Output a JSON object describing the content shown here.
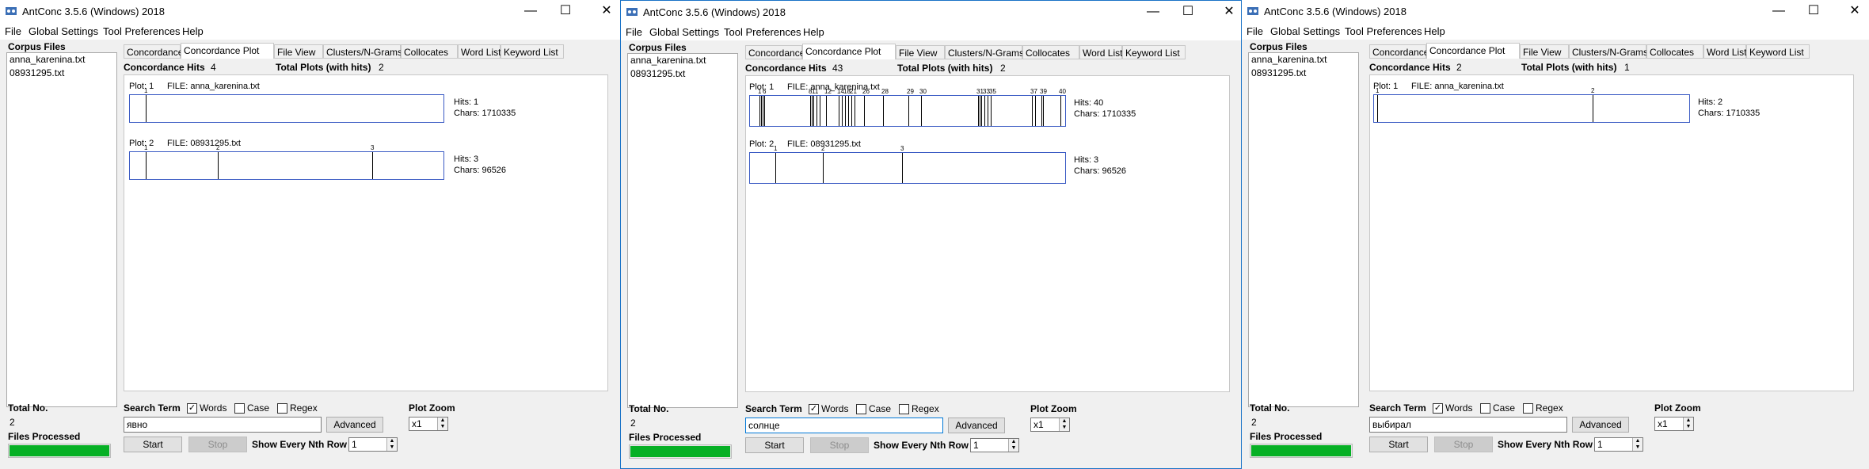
{
  "colors": {
    "progress": "#06b025",
    "plot_border": "#3b5bc4",
    "active_window_border": "#1a73c7"
  },
  "windows": [
    {
      "title": "AntConc 3.5.6 (Windows) 2018",
      "menu": [
        "File",
        "Global Settings",
        "Tool Preferences",
        "Help"
      ],
      "corpus_files_label": "Corpus Files",
      "corpus_files": [
        "anna_karenina.txt",
        "08931295.txt"
      ],
      "total_no_label": "Total No.",
      "total_no": "2",
      "files_processed_label": "Files Processed",
      "files_processed_fraction": 1.0,
      "tabs": [
        "Concordance",
        "Concordance Plot",
        "File View",
        "Clusters/N-Grams",
        "Collocates",
        "Word List",
        "Keyword List"
      ],
      "selected_tab": 1,
      "hits_label": "Concordance Hits",
      "hits": "4",
      "total_plots_label": "Total Plots (with hits)",
      "total_plots": "2",
      "plots": [
        {
          "plot_label": "Plot: 1",
          "file_label": "FILE: anna_karenina.txt",
          "hits_text": "Hits: 1",
          "chars_text": "Chars: 1710335",
          "marks": [
            {
              "pos": 0.05,
              "n": "1"
            }
          ]
        },
        {
          "plot_label": "Plot: 2",
          "file_label": "FILE: 08931295.txt",
          "hits_text": "Hits: 3",
          "chars_text": "Chars: 96526",
          "marks": [
            {
              "pos": 0.05,
              "n": "1"
            },
            {
              "pos": 0.28,
              "n": "2"
            },
            {
              "pos": 0.77,
              "n": "3"
            }
          ]
        }
      ],
      "search_term_label": "Search Term",
      "words_label": "Words",
      "words_checked": true,
      "case_label": "Case",
      "case_checked": false,
      "regex_label": "Regex",
      "regex_checked": false,
      "search_value": "явно",
      "advanced_label": "Advanced",
      "start_label": "Start",
      "stop_label": "Stop",
      "nth_row_label": "Show Every Nth Row",
      "nth_row_value": "1",
      "plot_zoom_label": "Plot Zoom",
      "plot_zoom_value": "x1"
    },
    {
      "title": "AntConc 3.5.6 (Windows) 2018",
      "menu": [
        "File",
        "Global Settings",
        "Tool Preferences",
        "Help"
      ],
      "corpus_files_label": "Corpus Files",
      "corpus_files": [
        "anna_karenina.txt",
        "08931295.txt"
      ],
      "total_no_label": "Total No.",
      "total_no": "2",
      "files_processed_label": "Files Processed",
      "files_processed_fraction": 1.0,
      "tabs": [
        "Concordance",
        "Concordance Plot",
        "File View",
        "Clusters/N-Grams",
        "Collocates",
        "Word List",
        "Keyword List"
      ],
      "selected_tab": 1,
      "hits_label": "Concordance Hits",
      "hits": "43",
      "total_plots_label": "Total Plots (with hits)",
      "total_plots": "2",
      "plots": [
        {
          "plot_label": "Plot: 1",
          "file_label": "FILE: anna_karenina.txt",
          "hits_text": "Hits: 40",
          "chars_text": "Chars: 1710335",
          "marks": [
            {
              "pos": 0.03,
              "n": "1"
            },
            {
              "pos": 0.035,
              "n": ""
            },
            {
              "pos": 0.04,
              "n": ""
            },
            {
              "pos": 0.045,
              "n": "6"
            },
            {
              "pos": 0.19,
              "n": "8"
            },
            {
              "pos": 0.195,
              "n": ""
            },
            {
              "pos": 0.2,
              "n": "11"
            },
            {
              "pos": 0.21,
              "n": ""
            },
            {
              "pos": 0.22,
              "n": ""
            },
            {
              "pos": 0.24,
              "n": "12"
            },
            {
              "pos": 0.28,
              "n": "14"
            },
            {
              "pos": 0.29,
              "n": ""
            },
            {
              "pos": 0.3,
              "n": "18"
            },
            {
              "pos": 0.31,
              "n": ""
            },
            {
              "pos": 0.32,
              "n": "21"
            },
            {
              "pos": 0.33,
              "n": ""
            },
            {
              "pos": 0.36,
              "n": "26"
            },
            {
              "pos": 0.42,
              "n": "28"
            },
            {
              "pos": 0.5,
              "n": "29"
            },
            {
              "pos": 0.54,
              "n": "30"
            },
            {
              "pos": 0.72,
              "n": "31"
            },
            {
              "pos": 0.725,
              "n": ""
            },
            {
              "pos": 0.73,
              "n": ""
            },
            {
              "pos": 0.74,
              "n": "33"
            },
            {
              "pos": 0.75,
              "n": ""
            },
            {
              "pos": 0.76,
              "n": "35"
            },
            {
              "pos": 0.89,
              "n": "37"
            },
            {
              "pos": 0.9,
              "n": ""
            },
            {
              "pos": 0.92,
              "n": "39"
            },
            {
              "pos": 0.925,
              "n": ""
            },
            {
              "pos": 0.98,
              "n": "40"
            }
          ]
        },
        {
          "plot_label": "Plot: 2",
          "file_label": "FILE: 08931295.txt",
          "hits_text": "Hits: 3",
          "chars_text": "Chars: 96526",
          "marks": [
            {
              "pos": 0.08,
              "n": "1"
            },
            {
              "pos": 0.23,
              "n": "2"
            },
            {
              "pos": 0.48,
              "n": "3"
            }
          ]
        }
      ],
      "search_term_label": "Search Term",
      "words_label": "Words",
      "words_checked": true,
      "case_label": "Case",
      "case_checked": false,
      "regex_label": "Regex",
      "regex_checked": false,
      "search_value": "солнце",
      "advanced_label": "Advanced",
      "start_label": "Start",
      "stop_label": "Stop",
      "nth_row_label": "Show Every Nth Row",
      "nth_row_value": "1",
      "plot_zoom_label": "Plot Zoom",
      "plot_zoom_value": "x1"
    },
    {
      "title": "AntConc 3.5.6 (Windows) 2018",
      "menu": [
        "File",
        "Global Settings",
        "Tool Preferences",
        "Help"
      ],
      "corpus_files_label": "Corpus Files",
      "corpus_files": [
        "anna_karenina.txt",
        "08931295.txt"
      ],
      "total_no_label": "Total No.",
      "total_no": "2",
      "files_processed_label": "Files Processed",
      "files_processed_fraction": 1.0,
      "tabs": [
        "Concordance",
        "Concordance Plot",
        "File View",
        "Clusters/N-Grams",
        "Collocates",
        "Word List",
        "Keyword List"
      ],
      "selected_tab": 1,
      "hits_label": "Concordance Hits",
      "hits": "2",
      "total_plots_label": "Total Plots (with hits)",
      "total_plots": "1",
      "plots": [
        {
          "plot_label": "Plot: 1",
          "file_label": "FILE: anna_karenina.txt",
          "hits_text": "Hits: 2",
          "chars_text": "Chars: 1710335",
          "marks": [
            {
              "pos": 0.01,
              "n": "1"
            },
            {
              "pos": 0.69,
              "n": "2"
            }
          ]
        }
      ],
      "search_term_label": "Search Term",
      "words_label": "Words",
      "words_checked": true,
      "case_label": "Case",
      "case_checked": false,
      "regex_label": "Regex",
      "regex_checked": false,
      "search_value": "выбирал",
      "advanced_label": "Advanced",
      "start_label": "Start",
      "stop_label": "Stop",
      "nth_row_label": "Show Every Nth Row",
      "nth_row_value": "1",
      "plot_zoom_label": "Plot Zoom",
      "plot_zoom_value": "x1"
    }
  ]
}
